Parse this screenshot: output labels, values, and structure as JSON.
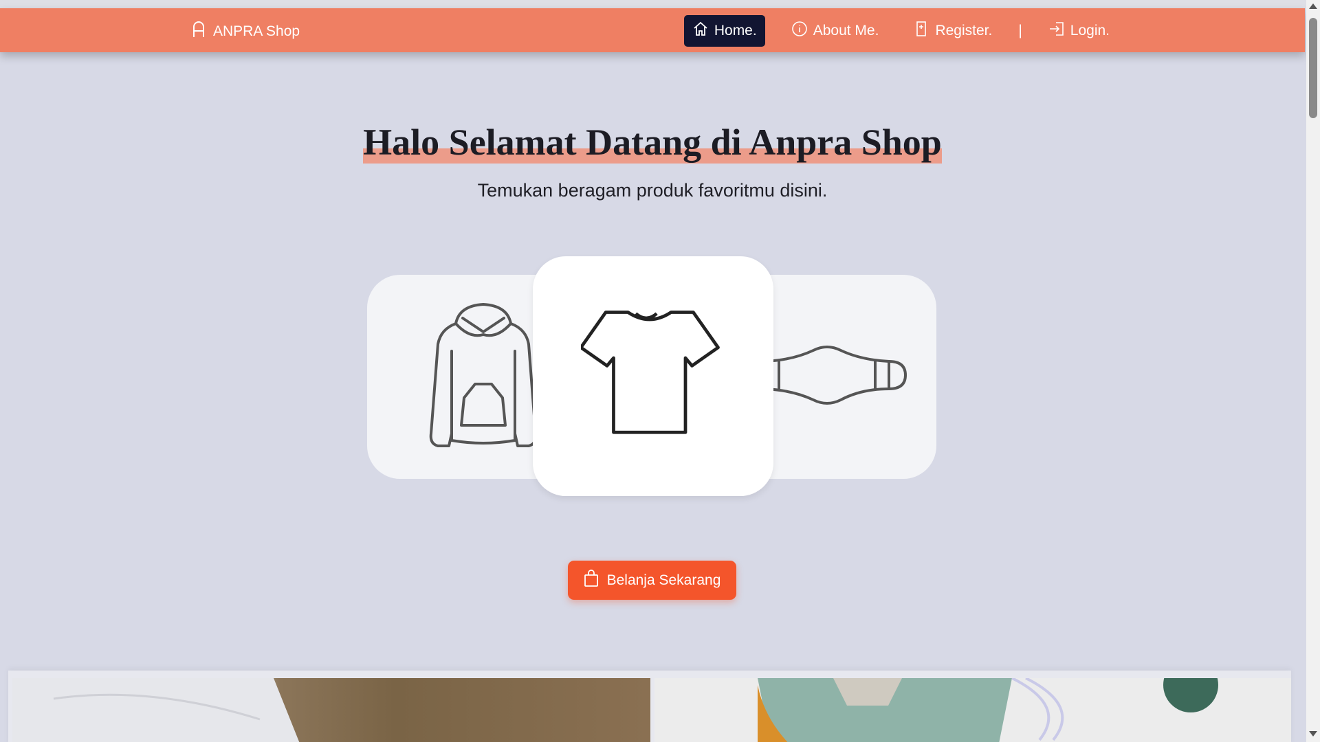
{
  "navbar": {
    "brand": "ANPRA Shop",
    "brand_icon": "letter-a-icon",
    "items": [
      {
        "label": "Home.",
        "icon": "home-icon",
        "active": true
      },
      {
        "label": "About Me.",
        "icon": "info-icon",
        "active": false
      },
      {
        "label": "Register.",
        "icon": "register-icon",
        "active": false
      },
      {
        "label": "Login.",
        "icon": "login-icon",
        "active": false
      }
    ],
    "separator": "|"
  },
  "hero": {
    "title": "Halo Selamat Datang di Anpra Shop",
    "subtitle": "Temukan beragam produk favoritmu disini."
  },
  "products": [
    {
      "icon": "hoodie-icon"
    },
    {
      "icon": "tshirt-icon"
    },
    {
      "icon": "mask-icon"
    }
  ],
  "cta": {
    "label": "Belanja Sekarang",
    "icon": "shopping-bag-icon"
  },
  "colors": {
    "navbar": "#ef7f63",
    "active_nav": "#121532",
    "page_bg": "#d7d9e6",
    "cta": "#f4552b",
    "title_highlight": "#ec9c8a"
  }
}
